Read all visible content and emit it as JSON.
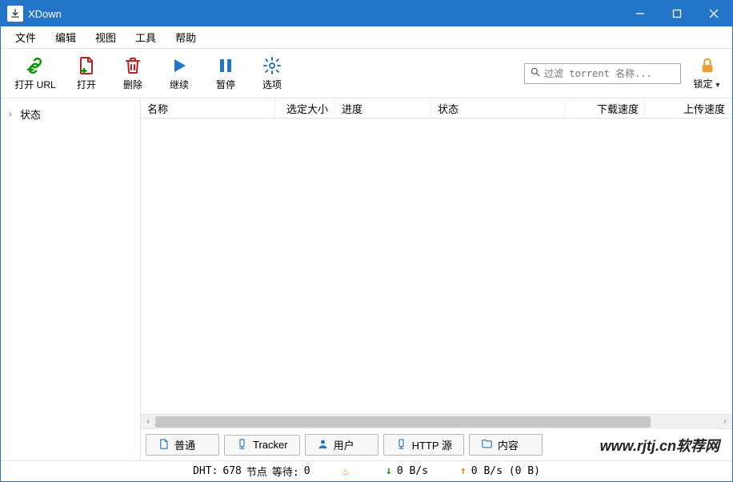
{
  "window": {
    "title": "XDown"
  },
  "menu": {
    "file": "文件",
    "edit": "编辑",
    "view": "视图",
    "tools": "工具",
    "help": "帮助"
  },
  "toolbar": {
    "open_url": "打开 URL",
    "open": "打开",
    "delete": "删除",
    "resume": "继续",
    "pause": "暂停",
    "options": "选项",
    "lock": "锁定"
  },
  "search": {
    "placeholder": "过滤 torrent 名称..."
  },
  "sidebar": {
    "status": "状态"
  },
  "columns": {
    "name": "名称",
    "selected_size": "选定大小",
    "progress": "进度",
    "status": "状态",
    "dl_speed": "下载速度",
    "ul_speed": "上传速度"
  },
  "tabs": {
    "general": "普通",
    "tracker": "Tracker",
    "peers": "用户",
    "http_source": "HTTP 源",
    "content": "内容"
  },
  "status": {
    "dht_label": "DHT:",
    "dht_nodes": "678",
    "dht_nodes_suffix": "节点",
    "wait_label": "等待:",
    "wait_value": "0",
    "flame": "",
    "down": "0 B/s",
    "up": "0 B/s (0 B)"
  },
  "watermark": "www.rjtj.cn软荐网",
  "colors": {
    "primary": "#2375c9",
    "green": "#009400",
    "orange": "#d98400",
    "red": "#c02020"
  }
}
